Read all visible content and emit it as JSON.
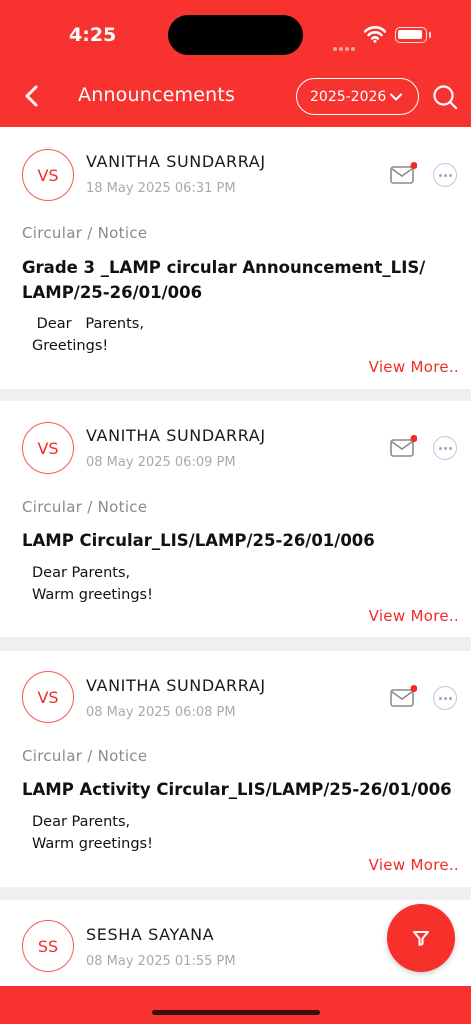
{
  "status_bar": {
    "time": "4:25"
  },
  "header": {
    "title": "Announcements",
    "year": "2025-2026"
  },
  "colors": {
    "brand": "#f8332f",
    "accent_text": "#f22b26",
    "unread_dot": "#f22b26"
  },
  "icons": {
    "back": "chevron-left-icon",
    "search": "search-icon",
    "mail": "mail-icon",
    "more": "more-icon",
    "filter": "filter-icon"
  },
  "announcements": [
    {
      "initials": "VS",
      "author": "VANITHA SUNDARRAJ",
      "date": "18 May 2025 06:31 PM",
      "category": "Circular / Notice",
      "title": "Grade 3 _LAMP circular Announcement_LIS/ LAMP/25-26/01/006",
      "body": [
        " Dear   Parents,",
        "Greetings!"
      ],
      "view_more": "View More.."
    },
    {
      "initials": "VS",
      "author": "VANITHA SUNDARRAJ",
      "date": "08 May 2025 06:09 PM",
      "category": "Circular / Notice",
      "title": "LAMP Circular_LIS/LAMP/25-26/01/006",
      "body": [
        "Dear Parents,",
        "Warm greetings!"
      ],
      "view_more": "View More.."
    },
    {
      "initials": "VS",
      "author": "VANITHA SUNDARRAJ",
      "date": "08 May 2025 06:08 PM",
      "category": "Circular / Notice",
      "title": "LAMP Activity Circular_LIS/LAMP/25-26/01/006",
      "body": [
        "Dear Parents,",
        "Warm greetings!"
      ],
      "view_more": "View More.."
    },
    {
      "initials": "SS",
      "author": "SESHA SAYANA",
      "date": "08 May 2025 01:55 PM"
    }
  ]
}
